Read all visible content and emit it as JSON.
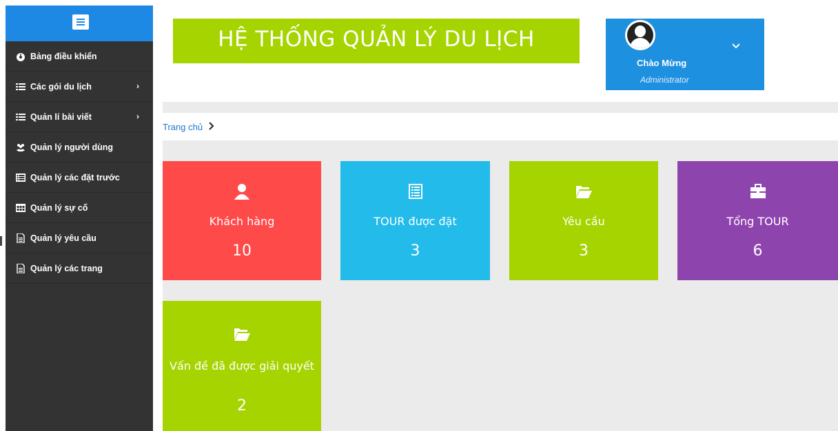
{
  "sidebar": {
    "items": [
      {
        "label": "Bảng điều khiển",
        "icon": "dashboard-icon",
        "has_submenu": false
      },
      {
        "label": "Các gói du lịch",
        "icon": "list-icon",
        "has_submenu": true
      },
      {
        "label": "Quản lí bài viết",
        "icon": "list-icon",
        "has_submenu": true
      },
      {
        "label": "Quản lý người dùng",
        "icon": "users-icon",
        "has_submenu": false
      },
      {
        "label": "Quản lý các đặt trước",
        "icon": "list-alt-icon",
        "has_submenu": false
      },
      {
        "label": "Quản lý sự cố",
        "icon": "table-icon",
        "has_submenu": false
      },
      {
        "label": "Quản lý yêu cầu",
        "icon": "file-icon",
        "has_submenu": false
      },
      {
        "label": "Quản lý các trang",
        "icon": "file-icon",
        "has_submenu": false
      }
    ],
    "submenu_chevron": "›"
  },
  "header": {
    "title": "HỆ THỐNG QUẢN LÝ DU LỊCH",
    "user_greeting": "Chào Mừng",
    "user_role": "Administrator",
    "dropdown_chevron": "⌵"
  },
  "breadcrumb": {
    "home": "Trang chủ",
    "separator": "›"
  },
  "cards": [
    {
      "label": "Khách hàng",
      "value": "10",
      "icon": "user-icon",
      "color": "#ff4a4a"
    },
    {
      "label": "TOUR được đặt",
      "value": "3",
      "icon": "list-box-icon",
      "color": "#22bbea"
    },
    {
      "label": "Yêu cầu",
      "value": "3",
      "icon": "folder-open-icon",
      "color": "#a6d400"
    },
    {
      "label": "Tổng TOUR",
      "value": "6",
      "icon": "briefcase-icon",
      "color": "#8e44ad"
    },
    {
      "label": "Vấn đề đã được giải quyết",
      "value": "2",
      "icon": "folder-open-icon",
      "color": "#a6d400"
    }
  ],
  "colors": {
    "sidebar_bg": "#333333",
    "accent_blue": "#1e88e5",
    "title_green": "#a6d400"
  }
}
